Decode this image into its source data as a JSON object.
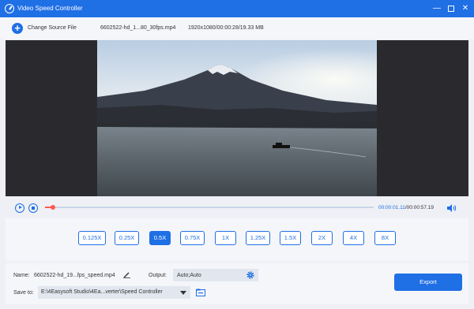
{
  "window": {
    "title": "Video Speed Controller",
    "minimize_symbol": "—",
    "close_symbol": "✕"
  },
  "topbar": {
    "add_symbol": "+",
    "change_source_label": "Change Source File",
    "file_name": "6602522-hd_1...80_30fps.mp4",
    "file_meta": "1920x1080/00:00:28/19.33 MB"
  },
  "player": {
    "current_time": "00:00:01.11",
    "separator": "/",
    "total_time": "00:00:57.19",
    "progress": 0.025
  },
  "speeds": {
    "options": [
      "0.125X",
      "0.25X",
      "0.5X",
      "0.75X",
      "1X",
      "1.25X",
      "1.5X",
      "2X",
      "4X",
      "8X"
    ],
    "selected": "0.5X"
  },
  "bottom": {
    "name_label": "Name:",
    "name_value": "6602522-hd_19...fps_speed.mp4",
    "output_label": "Output:",
    "output_value": "Auto;Auto",
    "save_to_label": "Save to:",
    "save_to_value": "E:\\4Easysoft Studio\\4Ea...verter\\Speed Controller",
    "export_label": "Export"
  },
  "colors": {
    "accent": "#1f6fe5",
    "progress": "#ff5a4f"
  }
}
